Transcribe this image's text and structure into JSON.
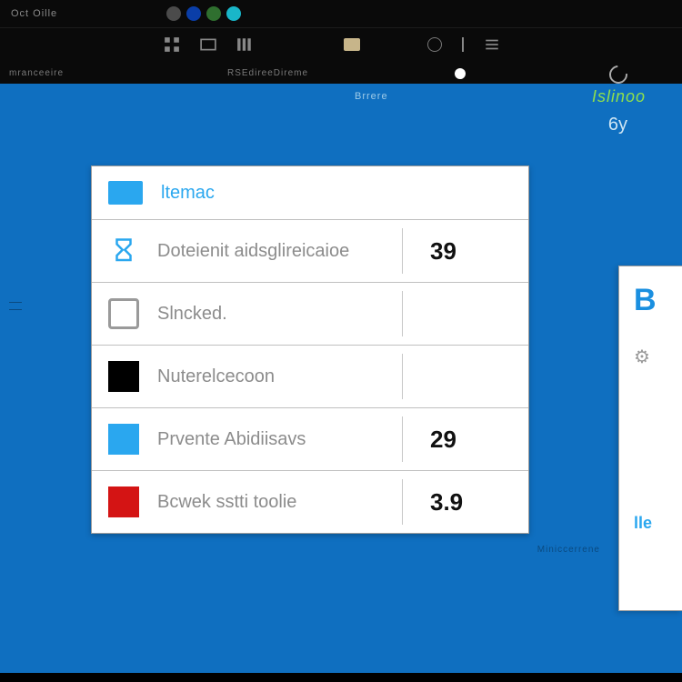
{
  "titlebar": {
    "text": "Oct  Oille"
  },
  "labelstrip": {
    "left": "mranceeire",
    "mid": "RSEdireeDireme"
  },
  "desktop": {
    "top_label": "Brrere",
    "right_label_green": "Islinoo",
    "right_value": "6y",
    "footer_label": "Miniccerrene"
  },
  "panel": {
    "header": {
      "title": "ltemac"
    },
    "rows": [
      {
        "icon": "hourglass",
        "label": "Doteienit aidsglireicaioe",
        "value": "39"
      },
      {
        "icon": "checkbox",
        "label": "Slncked.",
        "value": ""
      },
      {
        "icon": "black",
        "label": "Nuterelcecoon",
        "value": ""
      },
      {
        "icon": "cyan",
        "label": "Prvente Abidiisavs",
        "value": "29"
      },
      {
        "icon": "red",
        "label": "Bcwek sstti toolie",
        "value": "3.9"
      }
    ]
  },
  "sidecard": {
    "letter": "B",
    "icon_label": "⚙",
    "bottom_label": "lle"
  }
}
